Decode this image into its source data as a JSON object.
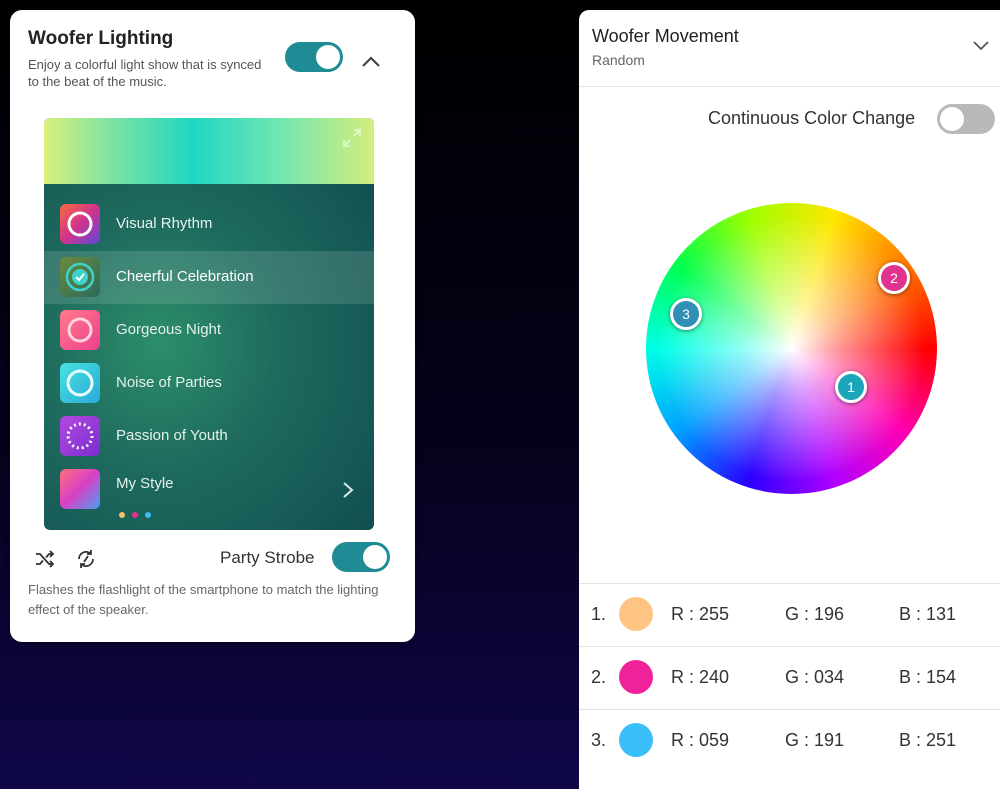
{
  "lighting": {
    "title": "Woofer Lighting",
    "description": "Enjoy a colorful light show that is synced to the beat of the music.",
    "enabled": true,
    "items": [
      {
        "label": "Visual Rhythm",
        "icon": "ring-gradient-icon"
      },
      {
        "label": "Cheerful Celebration",
        "icon": "checkmark-icon",
        "selected": true
      },
      {
        "label": "Gorgeous Night",
        "icon": "ring-pink-icon"
      },
      {
        "label": "Noise of Parties",
        "icon": "ring-cyan-icon"
      },
      {
        "label": "Passion of Youth",
        "icon": "dotted-ring-icon"
      },
      {
        "label": "My Style",
        "icon": "gradient-square-icon",
        "dot_colors": [
          "#f5c06a",
          "#ee2a95",
          "#3bb9f5"
        ]
      }
    ],
    "party_strobe": {
      "label": "Party Strobe",
      "enabled": true,
      "description": "Flashes the flashlight of the smartphone to match the lighting effect of the speaker."
    }
  },
  "movement": {
    "title": "Woofer Movement",
    "mode": "Random",
    "continuous_color_change": {
      "label": "Continuous Color Change",
      "enabled": false
    },
    "markers": [
      "1",
      "2",
      "3"
    ],
    "colors": [
      {
        "index": "1.",
        "hex": "#ffc483",
        "r": "R : 255",
        "g": "G : 196",
        "b": "B : 131"
      },
      {
        "index": "2.",
        "hex": "#f0229a",
        "r": "R : 240",
        "g": "G : 034",
        "b": "B : 154"
      },
      {
        "index": "3.",
        "hex": "#3bbffb",
        "r": "R : 059",
        "g": "G : 191",
        "b": "B : 251"
      }
    ]
  },
  "accent": "#1e8b95"
}
